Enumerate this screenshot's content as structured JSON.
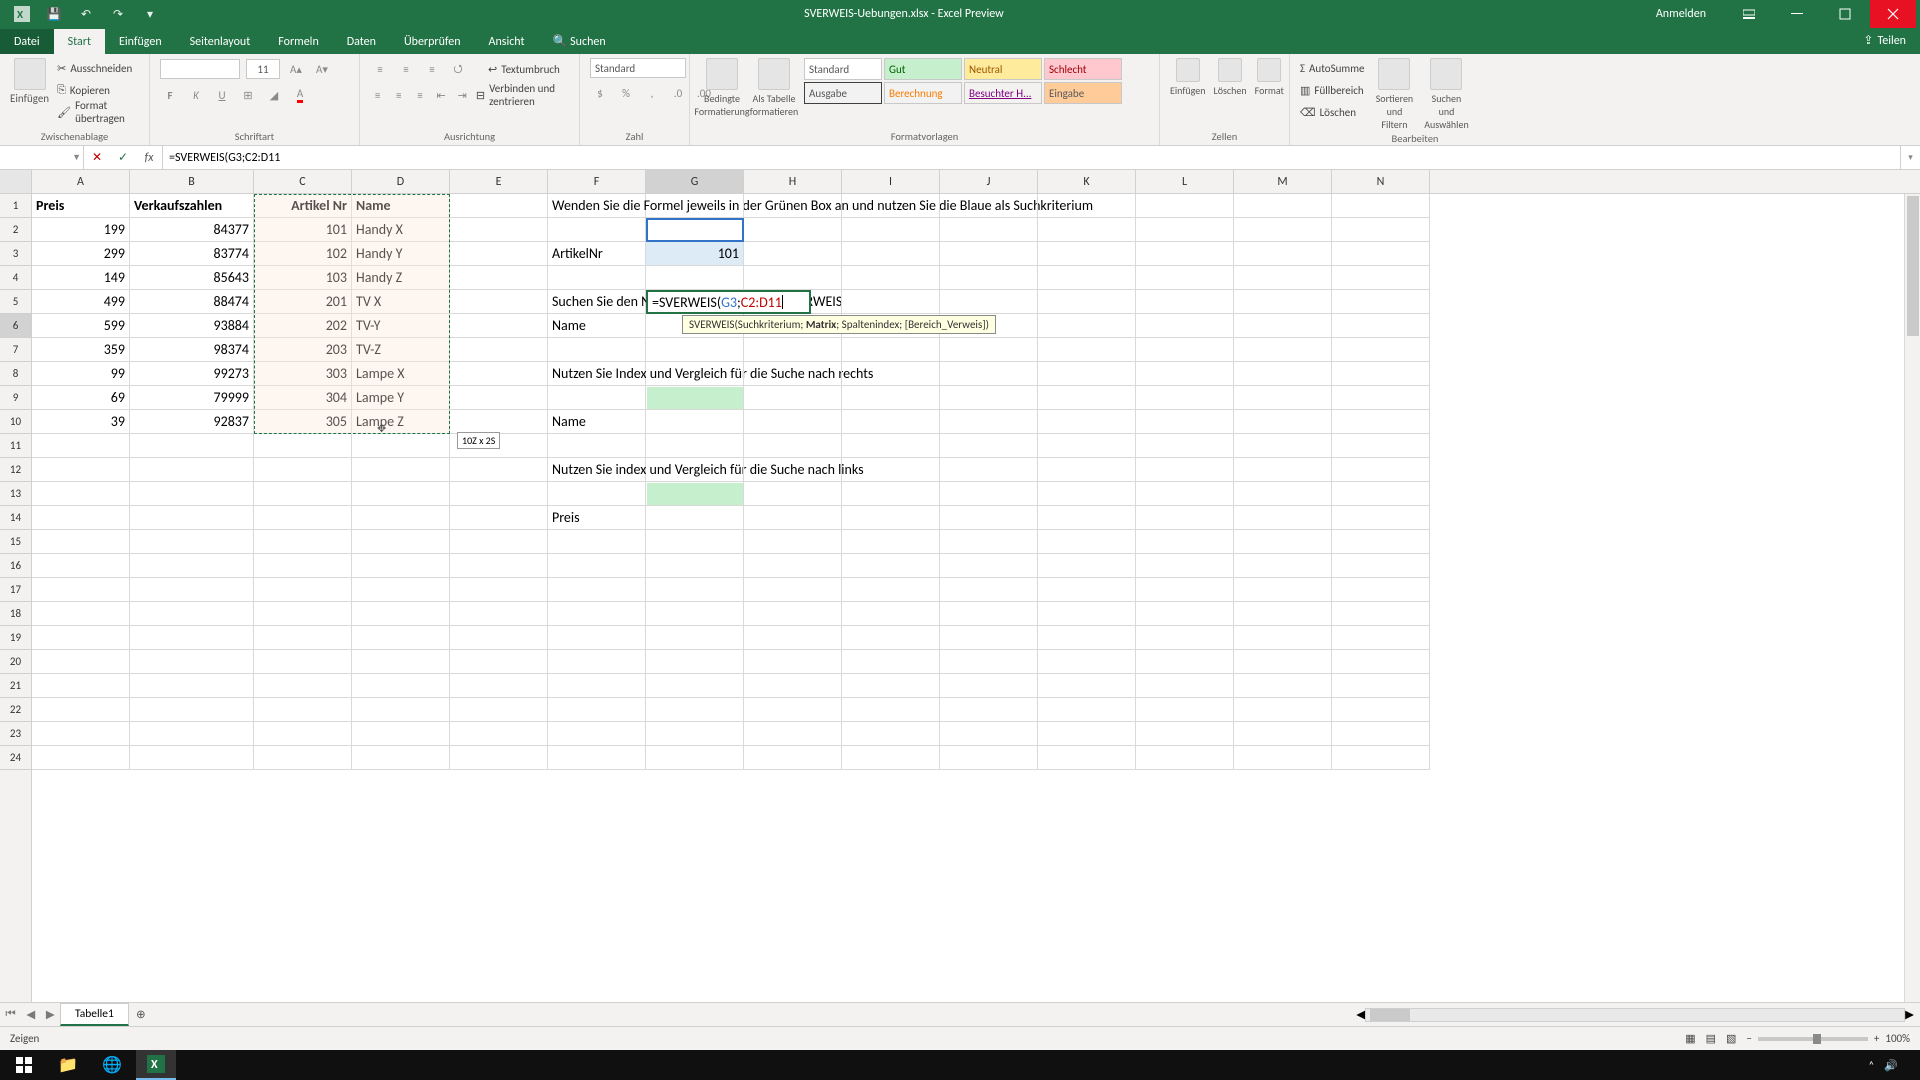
{
  "titlebar": {
    "title": "SVERWEIS-Uebungen.xlsx - Excel Preview",
    "signin": "Anmelden"
  },
  "tabs": {
    "file": "Datei",
    "start": "Start",
    "einfuegen": "Einfügen",
    "seitenlayout": "Seitenlayout",
    "formeln": "Formeln",
    "daten": "Daten",
    "ueberpruefen": "Überprüfen",
    "ansicht": "Ansicht",
    "suchen": "Suchen",
    "teilen": "Teilen"
  },
  "ribbon": {
    "clipboard": {
      "ausschneiden": "Ausschneiden",
      "kopieren": "Kopieren",
      "format": "Format übertragen",
      "label": "Zwischenablage",
      "paste": "Einfügen"
    },
    "font": {
      "label": "Schriftart",
      "size": "11"
    },
    "align": {
      "label": "Ausrichtung",
      "textumbruch": "Textumbruch",
      "verbinden": "Verbinden und zentrieren"
    },
    "number": {
      "label": "Zahl",
      "standard": "Standard"
    },
    "styles": {
      "label": "Formatvorlagen",
      "bedingte": "Bedingte\nFormatierung",
      "alstabelle": "Als Tabelle\nformatieren",
      "s1": "Standard",
      "s2": "Gut",
      "s3": "Neutral",
      "s4": "Schlecht",
      "s5": "Ausgabe",
      "s6": "Berechnung",
      "s7": "Besuchter H...",
      "s8": "Eingabe"
    },
    "cells": {
      "label": "Zellen",
      "einf": "Einfügen",
      "loesch": "Löschen",
      "format": "Format"
    },
    "edit": {
      "label": "Bearbeiten",
      "autosumme": "AutoSumme",
      "fuell": "Füllbereich",
      "loeschen": "Löschen",
      "sort": "Sortieren und\nFiltern",
      "find": "Suchen und\nAuswählen"
    }
  },
  "namebox": "",
  "formula": "=SVERWEIS(G3;C2:D11",
  "tooltip": "SVERWEIS(Suchkriterium; Matrix; Spaltenindex; [Bereich_Verweis])",
  "tooltip_bold": "Matrix",
  "sizehint": "10Z x 2S",
  "sheet": {
    "columns": [
      "A",
      "B",
      "C",
      "D",
      "E",
      "F",
      "G",
      "H",
      "I",
      "J",
      "K",
      "L",
      "M",
      "N"
    ],
    "headers": {
      "A": "Preis",
      "B": "Verkaufszahlen",
      "C": "Artikel Nr",
      "D": "Name"
    },
    "rows": [
      {
        "A": "199",
        "B": "84377",
        "C": "101",
        "D": "Handy X"
      },
      {
        "A": "299",
        "B": "83774",
        "C": "102",
        "D": "Handy Y"
      },
      {
        "A": "149",
        "B": "85643",
        "C": "103",
        "D": "Handy Z"
      },
      {
        "A": "499",
        "B": "88474",
        "C": "201",
        "D": "TV X"
      },
      {
        "A": "599",
        "B": "93884",
        "C": "202",
        "D": "TV-Y"
      },
      {
        "A": "359",
        "B": "98374",
        "C": "203",
        "D": "TV-Z"
      },
      {
        "A": "99",
        "B": "99273",
        "C": "303",
        "D": "Lampe X"
      },
      {
        "A": "69",
        "B": "79999",
        "C": "304",
        "D": "Lampe Y"
      },
      {
        "A": "39",
        "B": "92837",
        "C": "305",
        "D": "Lampe Z"
      }
    ],
    "F1": "Wenden Sie die Formel jeweils in der Grünen Box an und nutzen Sie die Blaue als Suchkriterium",
    "F3": "ArtikelNr",
    "G3": "101",
    "F5": "Suchen Sie den Namen des Produkts mit SVERWEIS",
    "F6": "Name",
    "G6": "=SVERWEIS(G3;C2:D11",
    "F8": "Nutzen Sie Index und Vergleich für die Suche nach rechts",
    "F10": "Name",
    "F12": "Nutzen Sie index und Vergleich für die Suche nach links",
    "F14": "Preis"
  },
  "sheettab": "Tabelle1",
  "status": "Zeigen",
  "zoom": "100%"
}
